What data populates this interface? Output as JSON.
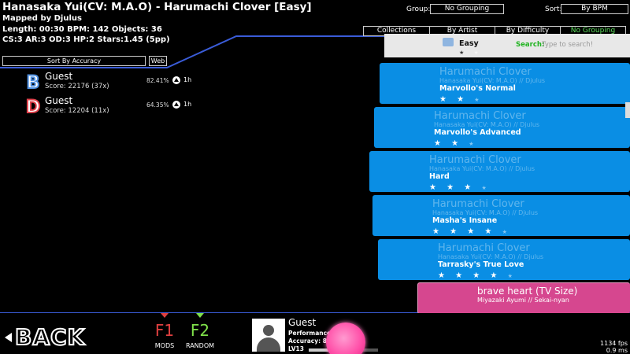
{
  "header": {
    "title": "Hanasaka Yui(CV: M.A.O) - Harumachi Clover [Easy]",
    "mapper": "Mapped by Djulus",
    "info1": "Length: 00:30 BPM: 142 Objects: 36",
    "info2": "CS:3 AR:3 OD:3 HP:2 Stars:1.45 (5pp)"
  },
  "controls": {
    "group_label": "Group:",
    "group_value": "No Grouping",
    "sort_label": "Sort:",
    "sort_value": "By BPM"
  },
  "tabs": [
    {
      "label": "Collections",
      "active": false
    },
    {
      "label": "By Artist",
      "active": false
    },
    {
      "label": "By Difficulty",
      "active": false
    },
    {
      "label": "No Grouping",
      "active": true
    }
  ],
  "leaderboard": {
    "sort_button": "Sort By Accuracy",
    "web_button": "Web",
    "scores": [
      {
        "grade": "B",
        "grade_color": "#4e8fe0",
        "name": "Guest",
        "score": "Score: 22176 (37x)",
        "accuracy": "82.41%",
        "time": "1h"
      },
      {
        "grade": "D",
        "grade_color": "#e0404a",
        "name": "Guest",
        "score": "Score: 12204 (11x)",
        "accuracy": "64.35%",
        "time": "1h"
      }
    ]
  },
  "selected": {
    "difficulty": "Easy",
    "search_label": "Search:",
    "search_placeholder": "Type to search!"
  },
  "songs": [
    {
      "title": "Harumachi Clover",
      "artist": "Hanasaka Yui(CV: M.A.O) // Djulus",
      "difficulty": "Marvollo's Normal",
      "stars": 2
    },
    {
      "title": "Harumachi Clover",
      "artist": "Hanasaka Yui(CV: M.A.O) // Djulus",
      "difficulty": "Marvollo's Advanced",
      "stars": 2
    },
    {
      "title": "Harumachi Clover",
      "artist": "Hanasaka Yui(CV: M.A.O) // Djulus",
      "difficulty": "Hard",
      "stars": 3
    },
    {
      "title": "Harumachi Clover",
      "artist": "Hanasaka Yui(CV: M.A.O) // Djulus",
      "difficulty": "Masha's Insane",
      "stars": 4
    },
    {
      "title": "Harumachi Clover",
      "artist": "Hanasaka Yui(CV: M.A.O) // Djulus",
      "difficulty": "Tarrasky's True Love",
      "stars": 4
    }
  ],
  "next_song": {
    "title": "brave heart (TV Size)",
    "artist": "Miyazaki Ayumi // Sekai-nyan"
  },
  "footer": {
    "back": "BACK",
    "f1_key": "F1",
    "f1_label": "MODS",
    "f1_color": "#e04040",
    "f2_key": "F2",
    "f2_label": "RANDOM",
    "f2_color": "#7fe04a",
    "player_name": "Guest",
    "performance": "Performance:",
    "accuracy": "Accuracy: 84.",
    "level": "LV13",
    "fps": "1134 fps",
    "ms": "0.9 ms"
  },
  "colors": {
    "accent_blue": "#3a5cd8",
    "panel_blue": "#0a8ee4",
    "panel_pink": "#d6478f"
  }
}
